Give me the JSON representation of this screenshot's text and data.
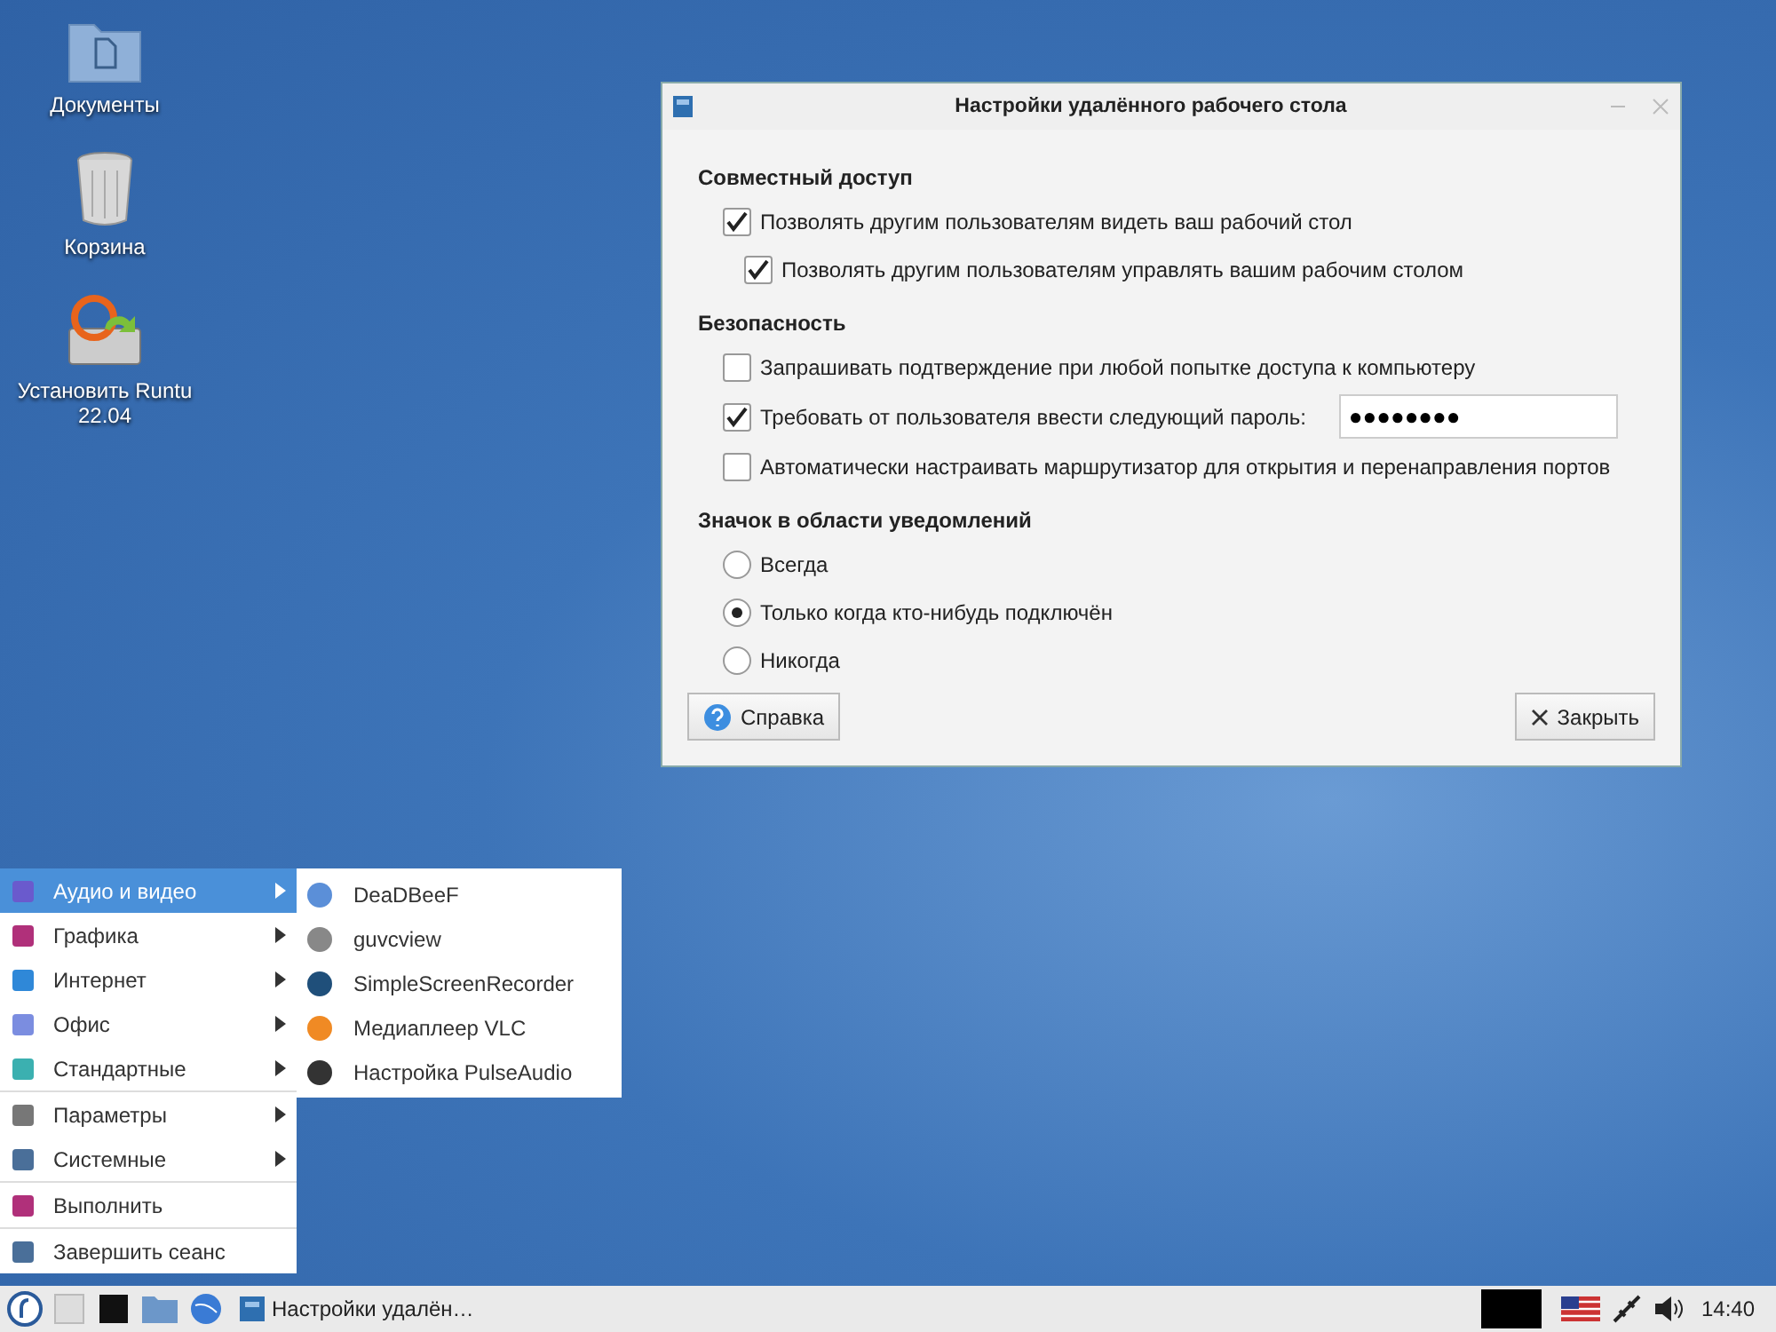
{
  "desktop_icons": [
    {
      "kind": "folder",
      "label": "Документы"
    },
    {
      "kind": "trash",
      "label": "Корзина"
    },
    {
      "kind": "installer",
      "label": "Установить Runtu 22.04"
    }
  ],
  "dialog": {
    "title": "Настройки удалённого рабочего стола",
    "sections": [
      {
        "heading": "Совместный доступ",
        "options": [
          {
            "kind": "checkbox",
            "label": "Позволять другим пользователям видеть ваш рабочий стол",
            "checked": true,
            "children": [
              {
                "kind": "checkbox",
                "label": "Позволять другим пользователям управлять вашим рабочим столом",
                "checked": true
              }
            ]
          }
        ]
      },
      {
        "heading": "Безопасность",
        "options": [
          {
            "kind": "checkbox",
            "label": "Запрашивать подтверждение при любой попытке доступа к компьютеру",
            "checked": false
          },
          {
            "kind": "password",
            "label": "Требовать от пользователя ввести следующий пароль:",
            "checked": true,
            "value": "●●●●●●●●"
          },
          {
            "kind": "checkbox",
            "label": "Автоматически настраивать маршрутизатор для открытия и перенаправления портов",
            "checked": false
          }
        ]
      },
      {
        "heading": "Значок в области уведомлений",
        "options": [
          {
            "kind": "radio",
            "label": "Всегда",
            "selected": false
          },
          {
            "kind": "radio",
            "label": "Только когда кто-нибудь подключён",
            "selected": true
          },
          {
            "kind": "radio",
            "label": "Никогда",
            "selected": false
          }
        ]
      }
    ],
    "buttons": [
      {
        "kind": "help",
        "label": "Справка"
      },
      {
        "kind": "close",
        "label": "Закрыть"
      }
    ]
  },
  "menu": {
    "groups": [
      [
        {
          "label": "Аудио и видео",
          "selected": true,
          "has_submenu": true
        },
        {
          "label": "Графика",
          "selected": false,
          "has_submenu": true
        },
        {
          "label": "Интернет",
          "selected": false,
          "has_submenu": true
        },
        {
          "label": "Офис",
          "selected": false,
          "has_submenu": true
        },
        {
          "label": "Стандартные",
          "selected": false,
          "has_submenu": true
        }
      ],
      [
        {
          "label": "Параметры",
          "selected": false,
          "has_submenu": true
        },
        {
          "label": "Системные",
          "selected": false,
          "has_submenu": true
        }
      ],
      [
        {
          "label": "Выполнить",
          "selected": false,
          "has_submenu": false
        }
      ],
      [
        {
          "label": "Завершить сеанс",
          "selected": false,
          "has_submenu": false
        }
      ]
    ],
    "submenu": [
      {
        "label": "DeaDBeeF",
        "color": "#5b8fd8"
      },
      {
        "label": "guvcview",
        "color": "#888888"
      },
      {
        "label": "SimpleScreenRecorder",
        "color": "#1f4f7a"
      },
      {
        "label": "Медиаплеер VLC",
        "color": "#f08a24"
      },
      {
        "label": "Настройка PulseAudio",
        "color": "#333333"
      }
    ]
  },
  "taskbar": {
    "task": "Настройки удалён…",
    "clock": "14:40"
  }
}
